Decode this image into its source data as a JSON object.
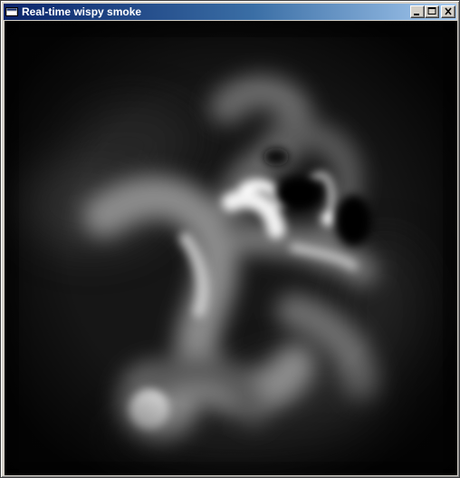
{
  "window": {
    "title": "Real-time wispy smoke",
    "icon": "app-window-icon",
    "buttons": {
      "minimize": "minimize-icon",
      "maximize": "maximize-icon",
      "close": "close-icon"
    },
    "colors": {
      "title_bar_start": "#0a246a",
      "title_bar_end": "#a6caf0",
      "frame": "#d4d0c8",
      "canvas_background": "#000000",
      "smoke": "#ffffff"
    }
  }
}
